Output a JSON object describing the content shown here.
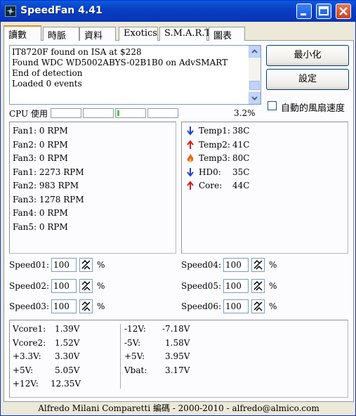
{
  "window": {
    "title": "SpeedFan 4.41"
  },
  "tabs": [
    "讀數",
    "時脈",
    "資料",
    "Exotics",
    "S.M.A.R.T.",
    "圖表"
  ],
  "log": {
    "lines": [
      "IT8720F found on ISA at $228",
      "Found WDC WD5002ABYS-02B1B0 on AdvSMART",
      "End of detection",
      "Loaded 0 events"
    ]
  },
  "buttons": {
    "minimize_label": "最小化",
    "settings_label": "設定"
  },
  "auto_fan": {
    "label": "自動的風扇速度",
    "checked": false
  },
  "cpu": {
    "label": "CPU 使用",
    "percent": "3.2%",
    "usage": 0.032
  },
  "fans": [
    {
      "name": "Fan1:",
      "value": "0 RPM"
    },
    {
      "name": "Fan2:",
      "value": "0 RPM"
    },
    {
      "name": "Fan3:",
      "value": "0 RPM"
    },
    {
      "name": "Fan1:",
      "value": "2273 RPM"
    },
    {
      "name": "Fan2:",
      "value": "983 RPM"
    },
    {
      "name": "Fan3:",
      "value": "1278 RPM"
    },
    {
      "name": "Fan4:",
      "value": "0 RPM"
    },
    {
      "name": "Fan5:",
      "value": "0 RPM"
    }
  ],
  "temps": [
    {
      "name": "Temp1:",
      "value": "38C",
      "icon": "arrow-down-icon",
      "color": "#1a3fd0"
    },
    {
      "name": "Temp2:",
      "value": "41C",
      "icon": "arrow-up-icon",
      "color": "#d41c1c"
    },
    {
      "name": "Temp3:",
      "value": "80C",
      "icon": "flame-icon",
      "color": "#e8651c"
    },
    {
      "name": "HD0:",
      "value": "35C",
      "icon": "arrow-down-icon",
      "color": "#1a3fd0"
    },
    {
      "name": "Core:",
      "value": "44C",
      "icon": "arrow-up-icon",
      "color": "#d41c1c"
    }
  ],
  "speeds": [
    {
      "label": "Speed01:",
      "value": "100",
      "unit": "%"
    },
    {
      "label": "Speed02:",
      "value": "100",
      "unit": "%"
    },
    {
      "label": "Speed03:",
      "value": "100",
      "unit": "%"
    },
    {
      "label": "Speed04:",
      "value": "100",
      "unit": "%"
    },
    {
      "label": "Speed05:",
      "value": "100",
      "unit": "%"
    },
    {
      "label": "Speed06:",
      "value": "100",
      "unit": "%"
    }
  ],
  "voltages_left": [
    {
      "name": "Vcore1:",
      "value": "1.39V"
    },
    {
      "name": "Vcore2:",
      "value": "1.52V"
    },
    {
      "name": "+3.3V:",
      "value": "3.30V"
    },
    {
      "name": "+5V:",
      "value": "5.05V"
    },
    {
      "name": "+12V:",
      "value": "12.35V"
    }
  ],
  "voltages_right": [
    {
      "name": "-12V:",
      "value": "-7.18V"
    },
    {
      "name": "-5V:",
      "value": "1.58V"
    },
    {
      "name": "+5V:",
      "value": "3.95V"
    },
    {
      "name": "Vbat:",
      "value": "3.17V"
    }
  ],
  "status_bar": {
    "text": "Alfredo Milani Comparetti 編碼 - 2000-2010 - alfredo@almico.com"
  }
}
